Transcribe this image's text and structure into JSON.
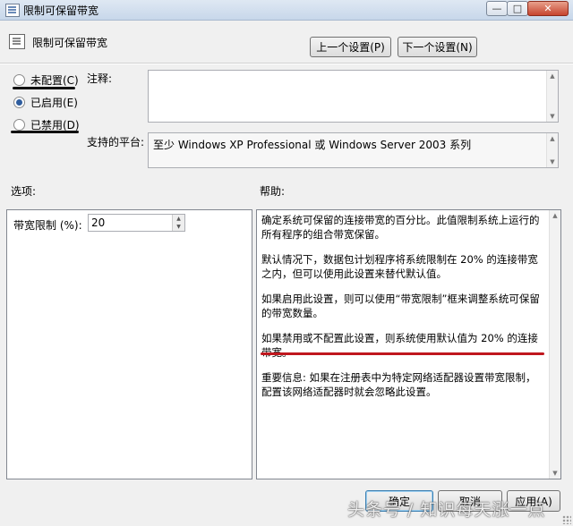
{
  "window": {
    "title": "限制可保留带宽",
    "min_glyph": "—",
    "max_glyph": "□",
    "close_glyph": "✕"
  },
  "header": {
    "policy_title": "限制可保留带宽",
    "prev_label": "上一个设置(P)",
    "next_label": "下一个设置(N)"
  },
  "state": {
    "options": [
      {
        "label": "未配置(C)",
        "selected": false
      },
      {
        "label": "已启用(E)",
        "selected": true
      },
      {
        "label": "已禁用(D)",
        "selected": false
      }
    ]
  },
  "comment": {
    "label": "注释:",
    "value": ""
  },
  "platform": {
    "label": "支持的平台:",
    "value": "至少 Windows XP Professional 或 Windows Server 2003 系列"
  },
  "options_panel": {
    "label": "选项:",
    "bandwidth_label": "带宽限制 (%):",
    "bandwidth_value": "20"
  },
  "help_panel": {
    "label": "帮助:",
    "paragraphs": [
      "确定系统可保留的连接带宽的百分比。此值限制系统上运行的所有程序的组合带宽保留。",
      "默认情况下，数据包计划程序将系统限制在 20% 的连接带宽之内，但可以使用此设置来替代默认值。",
      "如果启用此设置，则可以使用“带宽限制”框来调整系统可保留的带宽数量。",
      "如果禁用或不配置此设置，则系统使用默认值为 20% 的连接带宽。",
      "重要信息: 如果在注册表中为特定网络适配器设置带宽限制，配置该网络适配器时就会忽略此设置。"
    ]
  },
  "footer": {
    "ok_label": "确定",
    "cancel_label": "取消",
    "apply_label": "应用(A)"
  },
  "watermark": "头条号 / 知识每天涨一点",
  "colors": {
    "annotation_black": "#111111",
    "annotation_red": "#c0171e",
    "radio_selected": "#2f5d9e"
  }
}
